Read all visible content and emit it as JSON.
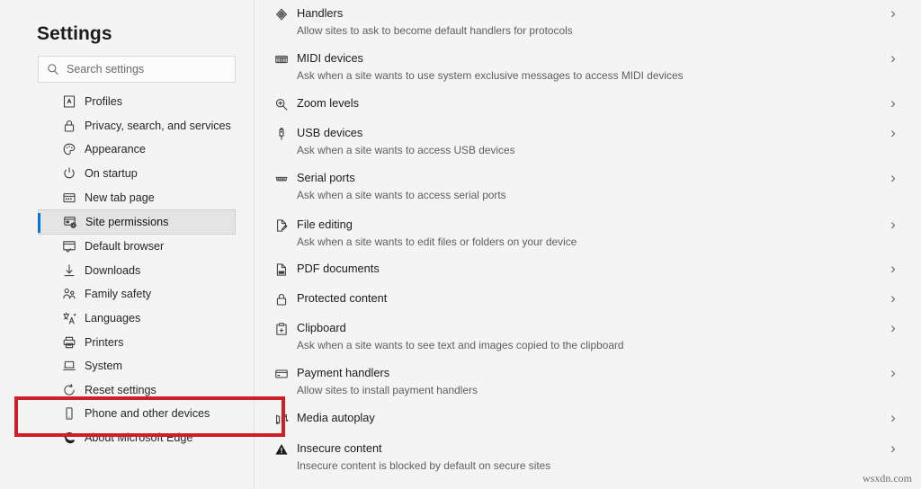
{
  "window": {
    "background_color": "#f4f4f4",
    "accent_color": "#0078d4",
    "highlight_color": "#cc1f28"
  },
  "sidebar": {
    "title": "Settings",
    "search": {
      "placeholder": "Search settings",
      "value": "",
      "icon": "search-icon"
    },
    "items": [
      {
        "label": "Profiles",
        "icon": "profile-card-icon",
        "selected": false
      },
      {
        "label": "Privacy, search, and services",
        "icon": "lock-icon",
        "selected": false
      },
      {
        "label": "Appearance",
        "icon": "palette-icon",
        "selected": false
      },
      {
        "label": "On startup",
        "icon": "power-icon",
        "selected": false
      },
      {
        "label": "New tab page",
        "icon": "new-tab-icon",
        "selected": false
      },
      {
        "label": "Site permissions",
        "icon": "site-permissions-icon",
        "selected": true
      },
      {
        "label": "Default browser",
        "icon": "default-browser-icon",
        "selected": false
      },
      {
        "label": "Downloads",
        "icon": "download-arrow-icon",
        "selected": false
      },
      {
        "label": "Family safety",
        "icon": "family-icon",
        "selected": false
      },
      {
        "label": "Languages",
        "icon": "languages-icon",
        "selected": false
      },
      {
        "label": "Printers",
        "icon": "printer-icon",
        "selected": false
      },
      {
        "label": "System",
        "icon": "laptop-icon",
        "selected": false
      },
      {
        "label": "Reset settings",
        "icon": "reset-circle-icon",
        "selected": false
      },
      {
        "label": "Phone and other devices",
        "icon": "phone-icon",
        "selected": false
      },
      {
        "label": "About Microsoft Edge",
        "icon": "edge-logo-icon",
        "selected": false
      }
    ]
  },
  "main": {
    "chevron_glyph": "›",
    "rows": [
      {
        "title": "Handlers",
        "desc": "Allow sites to ask to become default handlers for protocols",
        "icon": "handlers-icon",
        "highlighted": false
      },
      {
        "title": "MIDI devices",
        "desc": "Ask when a site wants to use system exclusive messages to access MIDI devices",
        "icon": "midi-keyboard-icon",
        "highlighted": false
      },
      {
        "title": "Zoom levels",
        "desc": "",
        "icon": "zoom-in-icon",
        "highlighted": false
      },
      {
        "title": "USB devices",
        "desc": "Ask when a site wants to access USB devices",
        "icon": "usb-icon",
        "highlighted": false
      },
      {
        "title": "Serial ports",
        "desc": "Ask when a site wants to access serial ports",
        "icon": "serial-port-icon",
        "highlighted": false
      },
      {
        "title": "File editing",
        "desc": "Ask when a site wants to edit files or folders on your device",
        "icon": "file-edit-icon",
        "highlighted": false
      },
      {
        "title": "PDF documents",
        "desc": "",
        "icon": "pdf-file-icon",
        "highlighted": false
      },
      {
        "title": "Protected content",
        "desc": "",
        "icon": "padlock-icon",
        "highlighted": false
      },
      {
        "title": "Clipboard",
        "desc": "Ask when a site wants to see text and images copied to the clipboard",
        "icon": "clipboard-icon",
        "highlighted": false
      },
      {
        "title": "Payment handlers",
        "desc": "Allow sites to install payment handlers",
        "icon": "credit-card-icon",
        "highlighted": false
      },
      {
        "title": "Media autoplay",
        "desc": "",
        "icon": "music-note-icon",
        "highlighted": true
      },
      {
        "title": "Insecure content",
        "desc": "Insecure content is blocked by default on secure sites",
        "icon": "warning-triangle-icon",
        "highlighted": false
      }
    ]
  },
  "watermark": {
    "text": "wsxdn.com"
  }
}
